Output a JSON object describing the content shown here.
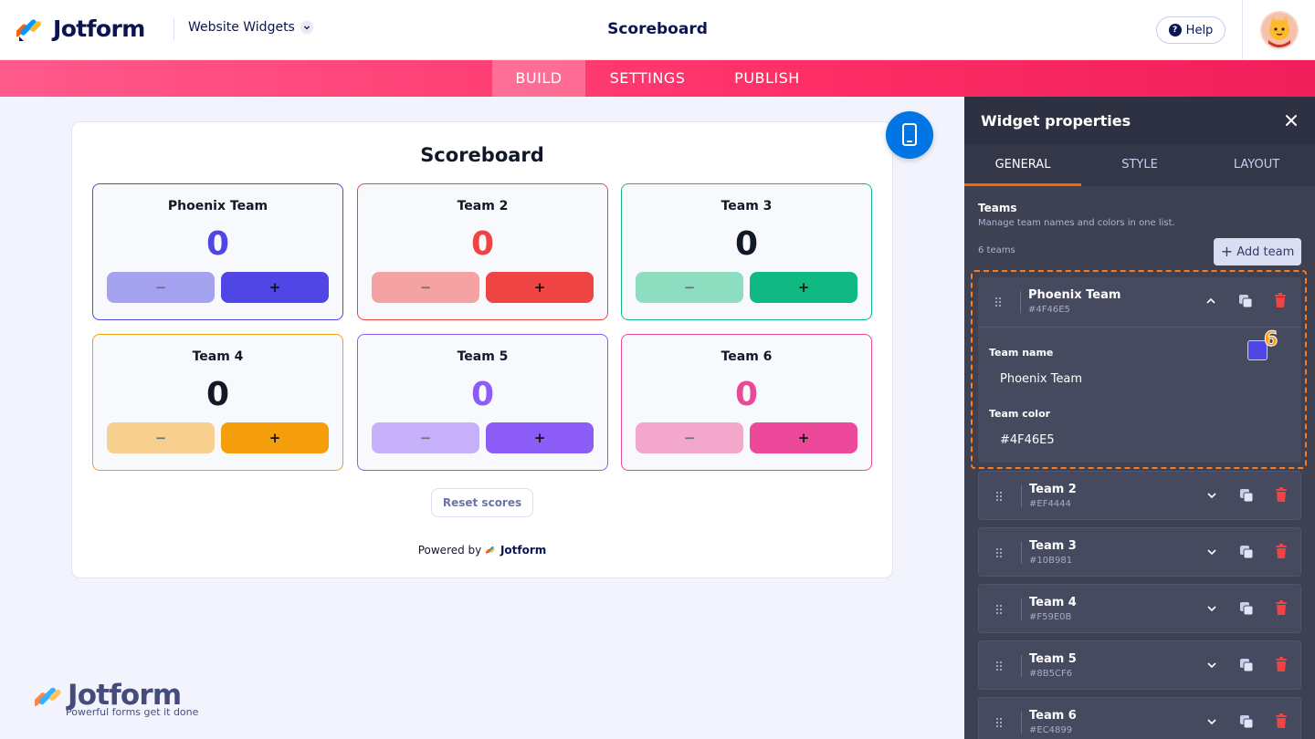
{
  "header": {
    "brand": "Jotform",
    "widget_selector": "Website Widgets",
    "title": "Scoreboard",
    "help_label": "Help"
  },
  "nav": {
    "tabs": [
      {
        "label": "BUILD",
        "active": true
      },
      {
        "label": "SETTINGS",
        "active": false
      },
      {
        "label": "PUBLISH",
        "active": false
      }
    ]
  },
  "preview": {
    "title": "Scoreboard",
    "minus_label": "−",
    "plus_label": "+",
    "reset_label": "Reset scores",
    "powered_by": "Powered by",
    "powered_brand": "Jotform",
    "teams": [
      {
        "name": "Phoenix Team",
        "score": "0",
        "color": "#4F46E5",
        "score_color": "#4F46E5",
        "light": "#A5A2F0"
      },
      {
        "name": "Team 2",
        "score": "0",
        "color": "#EF4444",
        "score_color": "#EF4444",
        "light": "#F4A2A2"
      },
      {
        "name": "Team 3",
        "score": "0",
        "color": "#10B981",
        "score_color": "#111827",
        "light": "#8DDDC1"
      },
      {
        "name": "Team 4",
        "score": "0",
        "color": "#F59E0B",
        "score_color": "#111827",
        "light": "#F7CF8F"
      },
      {
        "name": "Team 5",
        "score": "0",
        "color": "#8B5CF6",
        "score_color": "#8B5CF6",
        "light": "#C6B0F9"
      },
      {
        "name": "Team 6",
        "score": "0",
        "color": "#EC4899",
        "score_color": "#EC4899",
        "light": "#F3A7CB"
      }
    ]
  },
  "watermark": {
    "brand": "Jotform",
    "tagline": "Powerful forms get it done"
  },
  "panel": {
    "title": "Widget properties",
    "tabs": [
      {
        "label": "GENERAL",
        "active": true
      },
      {
        "label": "STYLE",
        "active": false
      },
      {
        "label": "LAYOUT",
        "active": false
      }
    ],
    "section_title": "Teams",
    "section_subtitle": "Manage team names and colors in one list.",
    "team_count": "6 teams",
    "add_team_label": "Add team",
    "step_badge": "6",
    "expanded": {
      "name": "Phoenix Team",
      "hex": "#4F46E5",
      "name_label": "Team name",
      "name_value": "Phoenix Team",
      "color_label": "Team color",
      "color_value": "#4F46E5"
    },
    "rows": [
      {
        "name": "Team 2",
        "hex": "#EF4444"
      },
      {
        "name": "Team 3",
        "hex": "#10B981"
      },
      {
        "name": "Team 4",
        "hex": "#F59E0B"
      },
      {
        "name": "Team 5",
        "hex": "#8B5CF6"
      },
      {
        "name": "Team 6",
        "hex": "#EC4899"
      }
    ]
  }
}
